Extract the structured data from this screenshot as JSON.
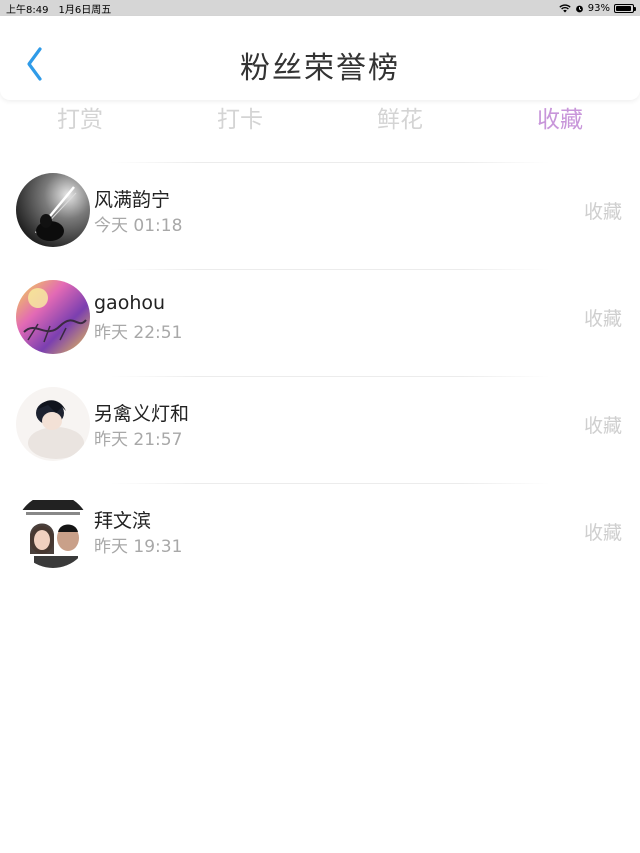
{
  "status_bar": {
    "time": "上午8:49",
    "date": "1月6日周五",
    "battery": "93%",
    "battery_level": 0.93
  },
  "header": {
    "title": "粉丝荣誉榜"
  },
  "tabs": [
    {
      "label": "打赏",
      "active": false
    },
    {
      "label": "打卡",
      "active": false
    },
    {
      "label": "鲜花",
      "active": false
    },
    {
      "label": "收藏",
      "active": true
    }
  ],
  "colors": {
    "accent": "#c896da",
    "back": "#2f9be8",
    "muted": "#a8a8a8"
  },
  "fans": [
    {
      "name": "风满韵宁",
      "time": "今天 01:18",
      "action": "收藏"
    },
    {
      "name": "gaohou",
      "time": "昨天 22:51",
      "action": "收藏"
    },
    {
      "name": "另禽义灯和",
      "time": "昨天 21:57",
      "action": "收藏"
    },
    {
      "name": "拜文滨",
      "time": "昨天 19:31",
      "action": "收藏"
    }
  ]
}
